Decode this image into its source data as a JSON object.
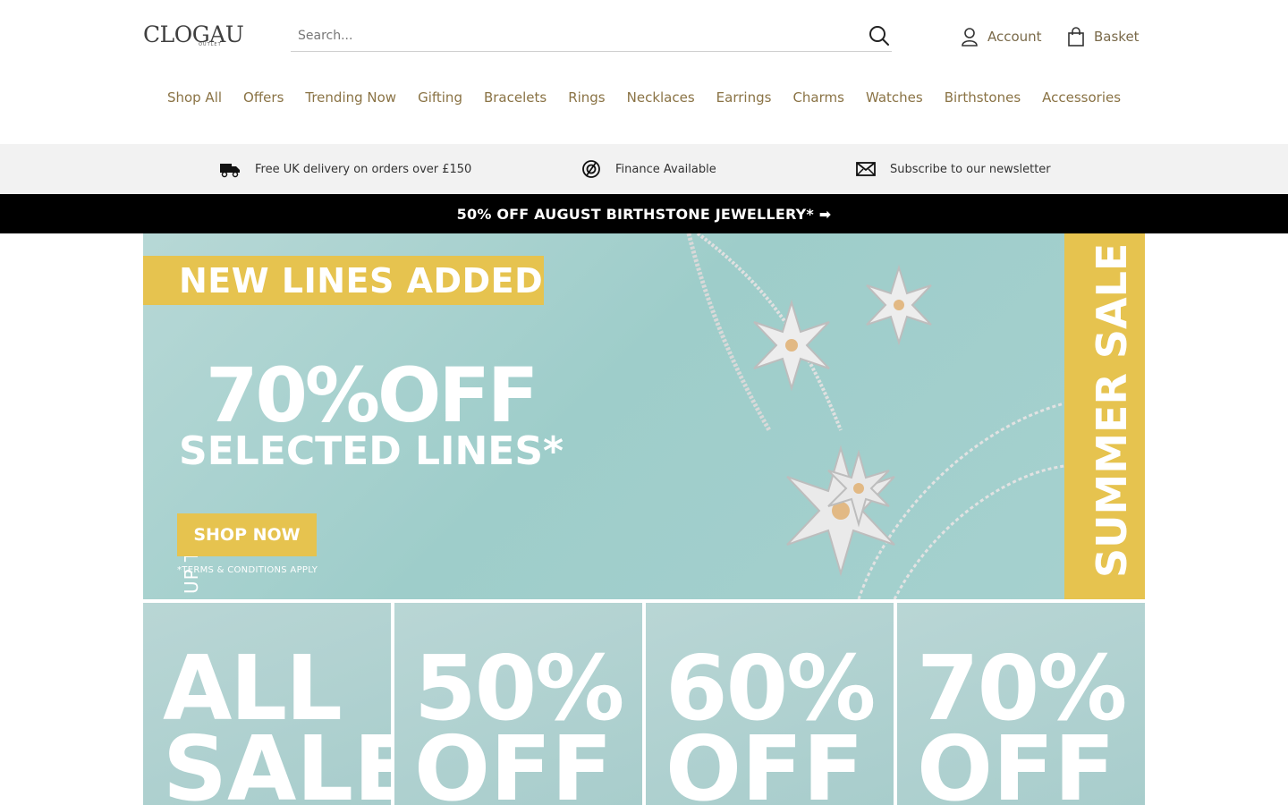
{
  "logo": {
    "text": "CLOGAU",
    "sub": "OUTLET"
  },
  "search": {
    "placeholder": "Search..."
  },
  "header": {
    "account_label": "Account",
    "basket_label": "Basket"
  },
  "nav": [
    "Shop All",
    "Offers",
    "Trending Now",
    "Gifting",
    "Bracelets",
    "Rings",
    "Necklaces",
    "Earrings",
    "Charms",
    "Watches",
    "Birthstones",
    "Accessories"
  ],
  "usps": [
    {
      "label": "Free UK delivery on orders over £150",
      "icon": "truck-icon"
    },
    {
      "label": "Finance Available",
      "icon": "finance-icon"
    },
    {
      "label": "Subscribe to our newsletter",
      "icon": "envelope-icon"
    }
  ],
  "promo": {
    "text": "50% OFF AUGUST BIRTHSTONE JEWELLERY* ➡"
  },
  "hero": {
    "band": "NEW LINES ADDED",
    "upto": "UP TO",
    "pct": "70%OFF",
    "lines": "SELECTED LINES*",
    "button": "SHOP NOW",
    "terms": "*TERMS & CONDITIONS APPLY",
    "side": "SUMMER SALE"
  },
  "tiles": [
    {
      "big": "ALL",
      "small": "SALE"
    },
    {
      "big": "50%",
      "small": "OFF"
    },
    {
      "big": "60%",
      "small": "OFF"
    },
    {
      "big": "70%",
      "small": "OFF"
    }
  ],
  "colors": {
    "gold": "#e6c34f",
    "nav_text": "#8a7345",
    "promo_bg": "#000000",
    "usp_bg": "#f2f2f2"
  }
}
